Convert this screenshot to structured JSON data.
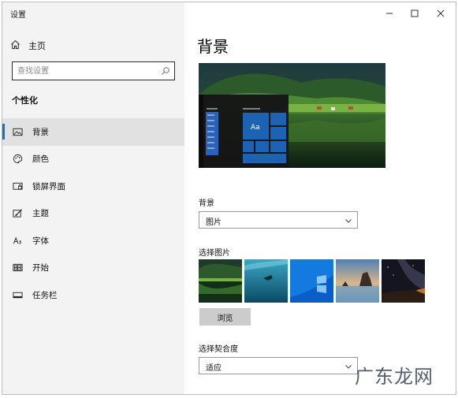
{
  "window": {
    "title": "设置"
  },
  "sidebar": {
    "home_label": "主页",
    "search_placeholder": "查找设置",
    "section_title": "个性化",
    "items": [
      {
        "label": "背景",
        "icon": "image-icon",
        "active": true
      },
      {
        "label": "颜色",
        "icon": "palette-icon",
        "active": false
      },
      {
        "label": "锁屏界面",
        "icon": "lock-screen-icon",
        "active": false
      },
      {
        "label": "主题",
        "icon": "theme-brush-icon",
        "active": false
      },
      {
        "label": "字体",
        "icon": "font-icon",
        "active": false
      },
      {
        "label": "开始",
        "icon": "start-menu-icon",
        "active": false
      },
      {
        "label": "任务栏",
        "icon": "taskbar-icon",
        "active": false
      }
    ]
  },
  "main": {
    "title": "背景",
    "preview": {
      "tile_text": "Aa"
    },
    "background": {
      "label": "背景",
      "value": "图片"
    },
    "choose_picture": {
      "label": "选择图片",
      "thumbnails": [
        "lake-landscape",
        "underwater",
        "windows-blue",
        "coastal-rocks",
        "night-sky"
      ]
    },
    "browse_label": "浏览",
    "fit": {
      "label": "选择契合度",
      "value": "适应"
    }
  },
  "watermark": "广东龙网",
  "colors": {
    "accent": "#0078d7",
    "sidebar_bg": "#f3f3f3",
    "active_item_bg": "#e1e1e1",
    "tile_blue": "#1c63b5"
  }
}
